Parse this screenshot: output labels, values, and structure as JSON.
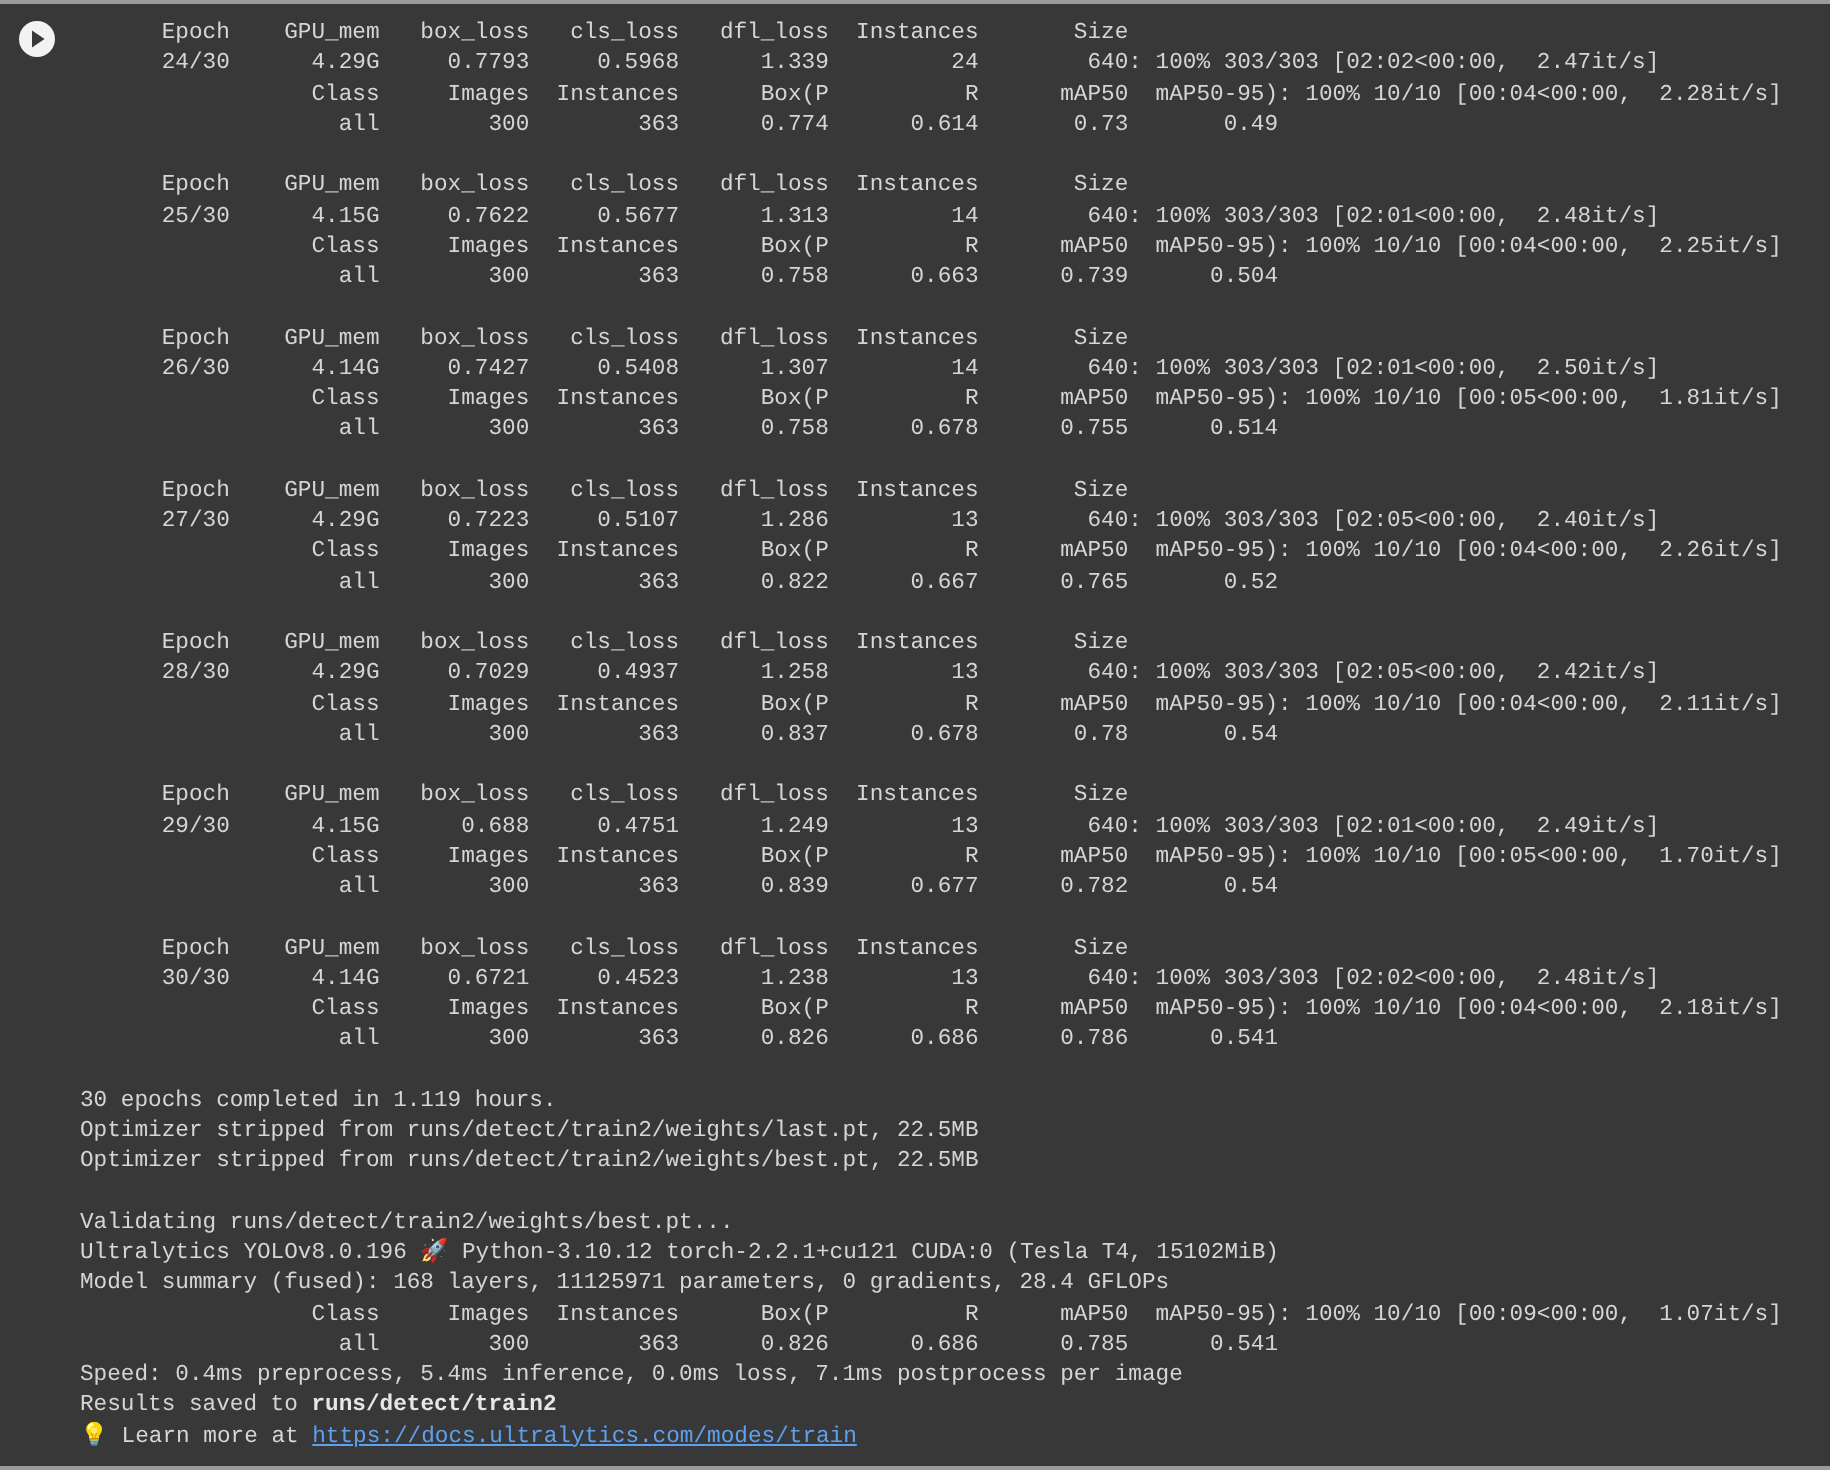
{
  "output_blocks": [
    {
      "lines": [
        {
          "text": "      Epoch    GPU_mem   box_loss   cls_loss   dfl_loss  Instances       Size"
        },
        {
          "text": "      24/30      4.29G     0.7793     0.5968      1.339         24        640: 100% 303/303 [02:02<00:00,  2.47it/s]"
        },
        {
          "text": "                 Class     Images  Instances      Box(P          R      mAP50  mAP50-95): 100% 10/10 [00:04<00:00,  2.28it/s]"
        },
        {
          "text": "                   all        300        363      0.774      0.614       0.73       0.49"
        }
      ]
    },
    {
      "lines": [
        {
          "text": "      Epoch    GPU_mem   box_loss   cls_loss   dfl_loss  Instances       Size"
        },
        {
          "text": "      25/30      4.15G     0.7622     0.5677      1.313         14        640: 100% 303/303 [02:01<00:00,  2.48it/s]"
        },
        {
          "text": "                 Class     Images  Instances      Box(P          R      mAP50  mAP50-95): 100% 10/10 [00:04<00:00,  2.25it/s]"
        },
        {
          "text": "                   all        300        363      0.758      0.663      0.739      0.504"
        }
      ]
    },
    {
      "lines": [
        {
          "text": "      Epoch    GPU_mem   box_loss   cls_loss   dfl_loss  Instances       Size"
        },
        {
          "text": "      26/30      4.14G     0.7427     0.5408      1.307         14        640: 100% 303/303 [02:01<00:00,  2.50it/s]"
        },
        {
          "text": "                 Class     Images  Instances      Box(P          R      mAP50  mAP50-95): 100% 10/10 [00:05<00:00,  1.81it/s]"
        },
        {
          "text": "                   all        300        363      0.758      0.678      0.755      0.514"
        }
      ]
    },
    {
      "lines": [
        {
          "text": "      Epoch    GPU_mem   box_loss   cls_loss   dfl_loss  Instances       Size"
        },
        {
          "text": "      27/30      4.29G     0.7223     0.5107      1.286         13        640: 100% 303/303 [02:05<00:00,  2.40it/s]"
        },
        {
          "text": "                 Class     Images  Instances      Box(P          R      mAP50  mAP50-95): 100% 10/10 [00:04<00:00,  2.26it/s]"
        },
        {
          "text": "                   all        300        363      0.822      0.667      0.765       0.52"
        }
      ]
    },
    {
      "lines": [
        {
          "text": "      Epoch    GPU_mem   box_loss   cls_loss   dfl_loss  Instances       Size"
        },
        {
          "text": "      28/30      4.29G     0.7029     0.4937      1.258         13        640: 100% 303/303 [02:05<00:00,  2.42it/s]"
        },
        {
          "text": "                 Class     Images  Instances      Box(P          R      mAP50  mAP50-95): 100% 10/10 [00:04<00:00,  2.11it/s]"
        },
        {
          "text": "                   all        300        363      0.837      0.678       0.78       0.54"
        }
      ]
    },
    {
      "lines": [
        {
          "text": "      Epoch    GPU_mem   box_loss   cls_loss   dfl_loss  Instances       Size"
        },
        {
          "text": "      29/30      4.15G      0.688     0.4751      1.249         13        640: 100% 303/303 [02:01<00:00,  2.49it/s]"
        },
        {
          "text": "                 Class     Images  Instances      Box(P          R      mAP50  mAP50-95): 100% 10/10 [00:05<00:00,  1.70it/s]"
        },
        {
          "text": "                   all        300        363      0.839      0.677      0.782       0.54"
        }
      ]
    },
    {
      "lines": [
        {
          "text": "      Epoch    GPU_mem   box_loss   cls_loss   dfl_loss  Instances       Size"
        },
        {
          "text": "      30/30      4.14G     0.6721     0.4523      1.238         13        640: 100% 303/303 [02:02<00:00,  2.48it/s]"
        },
        {
          "text": "                 Class     Images  Instances      Box(P          R      mAP50  mAP50-95): 100% 10/10 [00:04<00:00,  2.18it/s]"
        },
        {
          "text": "                   all        300        363      0.826      0.686      0.786      0.541"
        }
      ]
    },
    {
      "lines": [
        {
          "text": "30 epochs completed in 1.119 hours."
        },
        {
          "text": "Optimizer stripped from runs/detect/train2/weights/last.pt, 22.5MB"
        },
        {
          "text": "Optimizer stripped from runs/detect/train2/weights/best.pt, 22.5MB"
        }
      ]
    },
    {
      "lines": [
        {
          "text": "Validating runs/detect/train2/weights/best.pt..."
        },
        {
          "text": "Ultralytics YOLOv8.0.196 🚀 Python-3.10.12 torch-2.2.1+cu121 CUDA:0 (Tesla T4, 15102MiB)"
        },
        {
          "text": "Model summary (fused): 168 layers, 11125971 parameters, 0 gradients, 28.4 GFLOPs"
        },
        {
          "text": "                 Class     Images  Instances      Box(P          R      mAP50  mAP50-95): 100% 10/10 [00:09<00:00,  1.07it/s]"
        },
        {
          "text": "                   all        300        363      0.826      0.686      0.785      0.541"
        },
        {
          "text": "Speed: 0.4ms preprocess, 5.4ms inference, 0.0ms loss, 7.1ms postprocess per image"
        },
        {
          "text": "Results saved to **runs/detect/train2**"
        },
        {
          "text": "💡 Learn more at ",
          "link": "https://docs.ultralytics.com/modes/train"
        }
      ]
    }
  ]
}
